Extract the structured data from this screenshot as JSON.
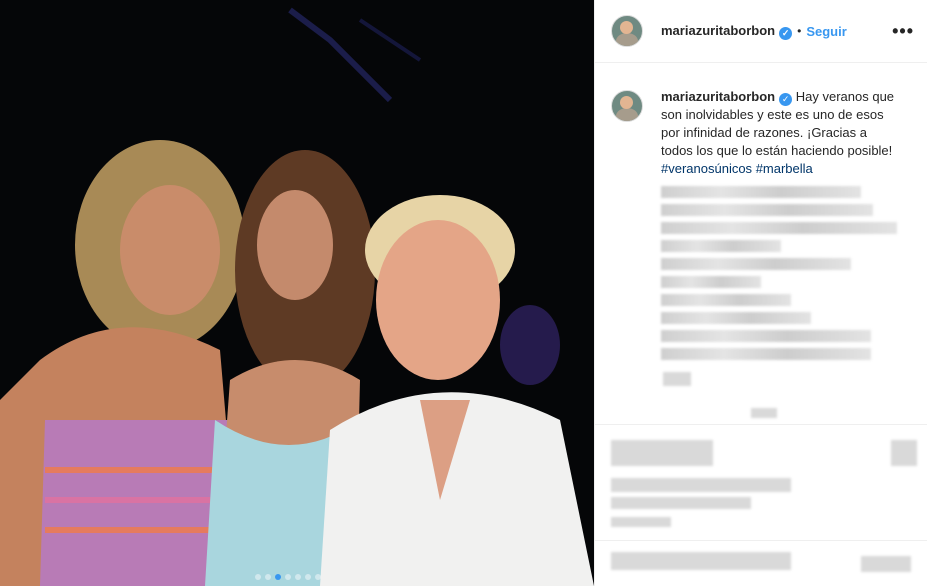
{
  "post": {
    "username": "mariazuritaborbon",
    "separator": "•",
    "follow_label": "Seguir",
    "more_label": "•••",
    "verified_mark": "✓"
  },
  "caption": {
    "username": "mariazuritaborbon",
    "text": "Hay veranos que son inolvidables y este es uno de esos por infinidad de razones. ¡Gracias a todos los que lo están haciendo posible! ",
    "hashtag1": "#veranosúnicos",
    "hashtag2": "#marbella"
  },
  "carousel": {
    "count": 7,
    "active": 2
  },
  "colors": {
    "accent": "#3897f0",
    "hashtag": "#003569",
    "text": "#262626"
  }
}
